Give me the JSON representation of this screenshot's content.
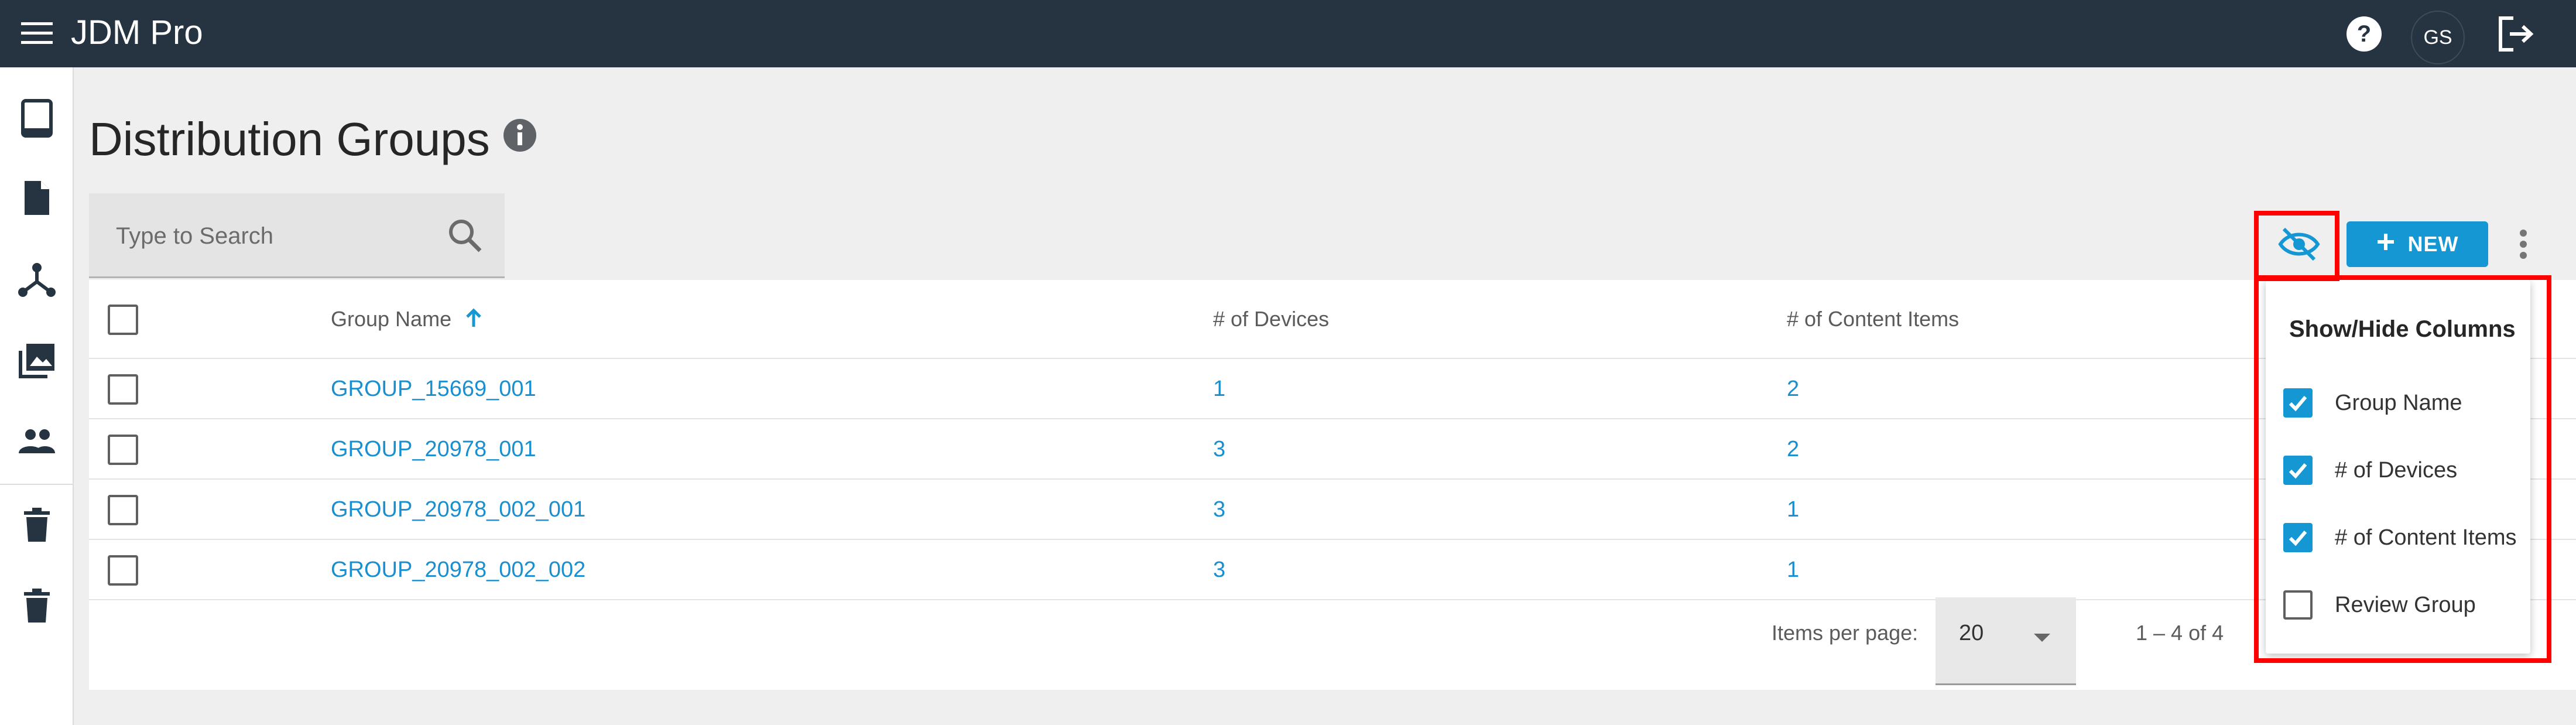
{
  "app": {
    "title": "JDM Pro",
    "avatar_initials": "GS"
  },
  "header_icons": [
    "menu-icon",
    "help-icon",
    "logout-icon"
  ],
  "sidebar": {
    "items": [
      {
        "icon": "tablet-icon"
      },
      {
        "icon": "document-icon"
      },
      {
        "icon": "network-icon"
      },
      {
        "icon": "gallery-icon"
      },
      {
        "icon": "groups-icon"
      },
      {
        "icon": "trash-icon"
      },
      {
        "icon": "trash-icon"
      }
    ]
  },
  "page": {
    "title": "Distribution Groups"
  },
  "search": {
    "placeholder": "Type to Search"
  },
  "toolbar": {
    "new_label": "NEW"
  },
  "table": {
    "columns": [
      "Group Name",
      "# of Devices",
      "# of Content Items"
    ],
    "sort": {
      "column": "Group Name",
      "direction": "ascending"
    },
    "rows": [
      {
        "name": "GROUP_15669_001",
        "devices": "1",
        "content": "2"
      },
      {
        "name": "GROUP_20978_001",
        "devices": "3",
        "content": "2"
      },
      {
        "name": "GROUP_20978_002_001",
        "devices": "3",
        "content": "1"
      },
      {
        "name": "GROUP_20978_002_002",
        "devices": "3",
        "content": "1"
      }
    ]
  },
  "paginator": {
    "items_per_page_label": "Items per page:",
    "items_per_page": "20",
    "range": "1 – 4 of 4"
  },
  "columns_panel": {
    "title": "Show/Hide Columns",
    "items": [
      {
        "label": "Group Name",
        "checked": true
      },
      {
        "label": "# of Devices",
        "checked": true
      },
      {
        "label": "# of Content Items",
        "checked": true
      },
      {
        "label": "Review Group",
        "checked": false
      }
    ]
  },
  "colors": {
    "accent": "#1597d4",
    "topbar": "#263340",
    "highlight": "#ff0000"
  }
}
